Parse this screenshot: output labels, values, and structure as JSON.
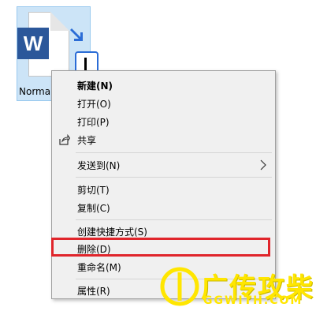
{
  "file": {
    "label": "Norma",
    "app_badge": "W",
    "icon": "word-document-icon"
  },
  "menu": {
    "items": [
      {
        "label": "新建(N)",
        "bold": true
      },
      {
        "label": "打开(O)"
      },
      {
        "label": "打印(P)"
      },
      {
        "label": "共享",
        "icon": "share-icon"
      },
      {
        "label": "发送到(N)",
        "submenu": true
      },
      {
        "label": "剪切(T)"
      },
      {
        "label": "复制(C)"
      },
      {
        "label": "创建快捷方式(S)"
      },
      {
        "label": "删除(D)",
        "highlighted": true
      },
      {
        "label": "重命名(M)"
      },
      {
        "label": "属性(R)"
      }
    ]
  },
  "colors": {
    "menu_bg": "#f0f0f0",
    "highlight_border": "#e0252b",
    "tile_bg": "#cce4f7",
    "word_blue": "#2b579a",
    "watermark": "#ffe600"
  },
  "watermark": {
    "main": "广传攻柴",
    "sub": "GGWITH.COM"
  }
}
